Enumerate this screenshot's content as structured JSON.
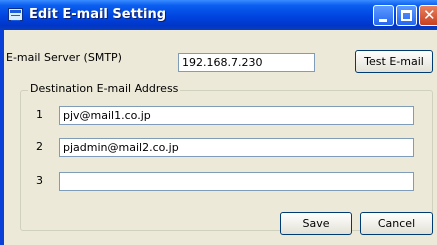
{
  "window": {
    "title": "Edit E-mail Setting"
  },
  "smtp": {
    "label": "E-mail Server (SMTP)",
    "value": "192.168.7.230",
    "test_button": "Test E-mail"
  },
  "destination": {
    "group_label": "Destination E-mail Address",
    "rows": [
      {
        "index": "1",
        "value": "pjv@mail1.co.jp"
      },
      {
        "index": "2",
        "value": "pjadmin@mail2.co.jp"
      },
      {
        "index": "3",
        "value": ""
      }
    ]
  },
  "footer": {
    "save_label": "Save",
    "cancel_label": "Cancel"
  },
  "colors": {
    "titlebar": "#0044e0",
    "dialog_bg": "#ece9d8",
    "close_button": "#c8401f"
  }
}
